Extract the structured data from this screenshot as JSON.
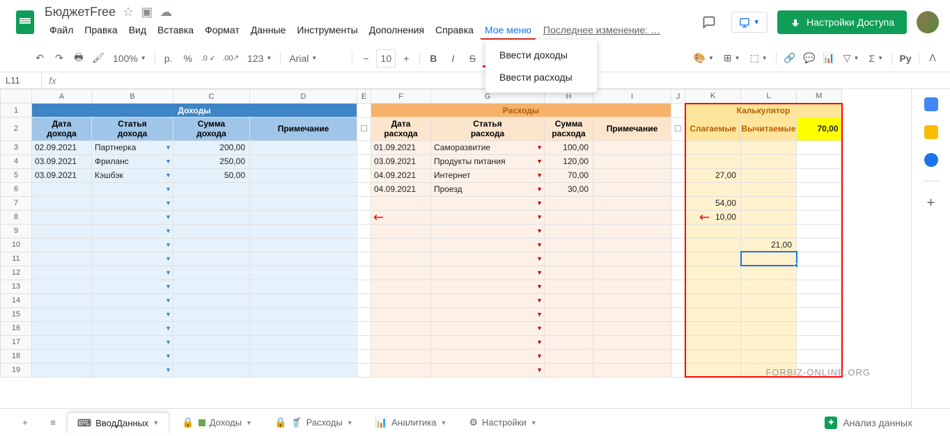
{
  "app": {
    "title": "БюджетFree",
    "last_edit": "Последнее изменение: …"
  },
  "menus": [
    "Файл",
    "Правка",
    "Вид",
    "Вставка",
    "Формат",
    "Данные",
    "Инструменты",
    "Дополнения",
    "Справка",
    "Мое меню"
  ],
  "custom_menu_items": [
    "Ввести доходы",
    "Ввести расходы"
  ],
  "share_button": "Настройки Доступа",
  "toolbar": {
    "zoom": "100%",
    "currency": "р.",
    "percent": "%",
    "dec_less": ".0",
    "dec_more": ".00",
    "more_formats": "123",
    "font": "Arial",
    "font_size": "10",
    "extension": "Pу"
  },
  "name_box": "L11",
  "columns": [
    "A",
    "B",
    "C",
    "D",
    "E",
    "F",
    "G",
    "H",
    "I",
    "J",
    "K",
    "L",
    "M"
  ],
  "row_count": 19,
  "sections": {
    "income": {
      "title": "Доходы",
      "headers": [
        "Дата дохода",
        "Статья дохода",
        "Сумма дохода",
        "Примечание"
      ],
      "rows": [
        {
          "date": "02.09.2021",
          "item": "Партнерка",
          "sum": "200,00",
          "note": ""
        },
        {
          "date": "03.09.2021",
          "item": "Фриланс",
          "sum": "250,00",
          "note": ""
        },
        {
          "date": "03.09.2021",
          "item": "Кэшбэк",
          "sum": "50,00",
          "note": ""
        }
      ]
    },
    "expense": {
      "title": "Расходы",
      "headers": [
        "Дата расхода",
        "Статья расхода",
        "Сумма расхода",
        "Примечание"
      ],
      "rows": [
        {
          "date": "01.09.2021",
          "item": "Саморазвитие",
          "sum": "100,00",
          "note": ""
        },
        {
          "date": "03.09.2021",
          "item": "Продукты питания",
          "sum": "120,00",
          "note": ""
        },
        {
          "date": "04.09.2021",
          "item": "Интернет",
          "sum": "70,00",
          "note": ""
        },
        {
          "date": "04.09.2021",
          "item": "Проезд",
          "sum": "30,00",
          "note": ""
        }
      ]
    },
    "calc": {
      "title": "Калькулятор",
      "headers": [
        "Слагаемые",
        "Вычитаемые"
      ],
      "result": "70,00",
      "rows": [
        {
          "add": "",
          "sub": ""
        },
        {
          "add": "",
          "sub": ""
        },
        {
          "add": "27,00",
          "sub": ""
        },
        {
          "add": "",
          "sub": ""
        },
        {
          "add": "54,00",
          "sub": ""
        },
        {
          "add": "10,00",
          "sub": ""
        },
        {
          "add": "",
          "sub": ""
        },
        {
          "add": "",
          "sub": "21,00"
        }
      ]
    }
  },
  "tabs": [
    {
      "icon": "⌨",
      "label": "ВводДанных",
      "active": true
    },
    {
      "icon": "🔒",
      "label": "Доходы",
      "active": false,
      "extra": "green"
    },
    {
      "icon": "🔒",
      "label": "Расходы",
      "active": false,
      "extra": "cup"
    },
    {
      "icon": "📊",
      "label": "Аналитика",
      "active": false
    },
    {
      "icon": "⚙",
      "label": "Настройки",
      "active": false
    }
  ],
  "analyze": "Анализ данных",
  "watermark": "FORBIZ-ONLINE.ORG"
}
